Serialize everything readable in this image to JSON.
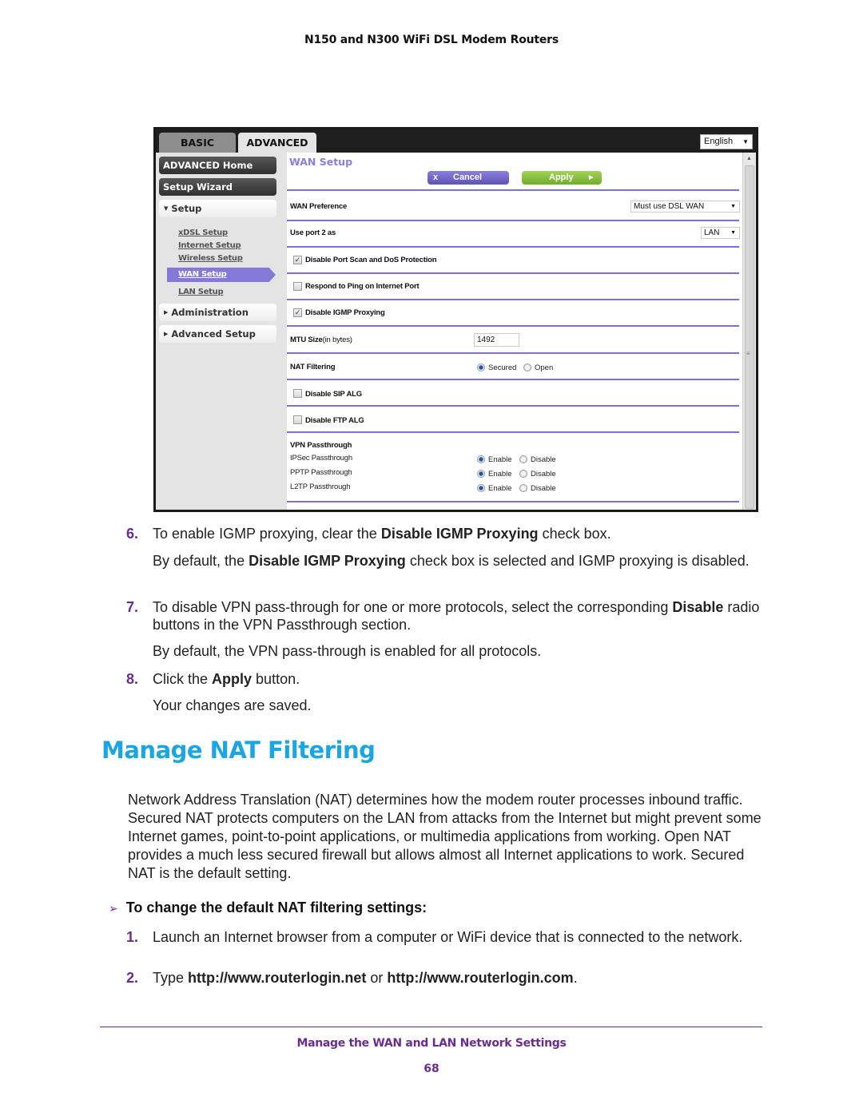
{
  "running_header": "N150 and N300 WiFi DSL Modem Routers",
  "router_ui": {
    "tabs": [
      {
        "label": "BASIC",
        "active": false
      },
      {
        "label": "ADVANCED",
        "active": true
      }
    ],
    "language_select": {
      "value": "English",
      "icon": "chevron-down-icon"
    },
    "sidebar": {
      "advanced_home": "ADVANCED Home",
      "setup_wizard": "Setup Wizard",
      "setup": {
        "label": "Setup",
        "expanded": true
      },
      "setup_links": [
        {
          "label": "xDSL Setup",
          "active": false
        },
        {
          "label": "Internet Setup",
          "active": false
        },
        {
          "label": "Wireless Setup",
          "active": false
        },
        {
          "label": "WAN Setup",
          "active": true
        },
        {
          "label": "LAN Setup",
          "active": false
        }
      ],
      "administration": "Administration",
      "advanced_setup": "Advanced Setup"
    },
    "page_title": "WAN Setup",
    "cancel_button": {
      "icon": "x",
      "label": "Cancel"
    },
    "apply_button": {
      "label": "Apply",
      "icon": "▸"
    },
    "wan_preference": {
      "label": "WAN Preference",
      "value": "Must use DSL WAN"
    },
    "use_port2": {
      "label": "Use port 2 as",
      "value": "LAN"
    },
    "checkboxes": {
      "disable_port_scan": {
        "label": "Disable Port Scan and DoS Protection",
        "checked": true
      },
      "respond_ping": {
        "label": "Respond to Ping on Internet Port",
        "checked": false
      },
      "disable_igmp": {
        "label": "Disable IGMP Proxying",
        "checked": true
      },
      "disable_sip": {
        "label": "Disable SIP ALG",
        "checked": false
      },
      "disable_ftp": {
        "label": "Disable FTP ALG",
        "checked": false
      }
    },
    "mtu": {
      "label": "MTU Size",
      "label_suffix": "(in bytes)",
      "value": "1492"
    },
    "nat_filtering": {
      "label": "NAT Filtering",
      "options": [
        "Secured",
        "Open"
      ],
      "selected": "Secured"
    },
    "vpn": {
      "heading": "VPN Passthrough",
      "enable_label": "Enable",
      "disable_label": "Disable",
      "rows": [
        {
          "label": "IPSec Passthrough",
          "selected": "Enable"
        },
        {
          "label": "PPTP Passthrough",
          "selected": "Enable"
        },
        {
          "label": "L2TP Passthrough",
          "selected": "Enable"
        }
      ]
    }
  },
  "steps_top": [
    {
      "num": "6.",
      "pre": "To enable IGMP proxying, clear the ",
      "bold": "Disable IGMP Proxying",
      "post": " check box."
    },
    {
      "num": "7.",
      "pre": "To disable VPN pass-through for one or more protocols, select the corresponding ",
      "bold": "Disable",
      "post": " radio buttons in the VPN Passthrough section."
    },
    {
      "num": "8.",
      "pre": "Click the ",
      "bold": "Apply",
      "post": " button."
    }
  ],
  "notes_top": [
    {
      "pre": "By default, the ",
      "bold": "Disable IGMP Proxying",
      "post": " check box is selected and IGMP proxying is disabled."
    },
    {
      "pre": "By default, the VPN pass-through is enabled for all protocols.",
      "bold": "",
      "post": ""
    },
    {
      "pre": "Your changes are saved.",
      "bold": "",
      "post": ""
    }
  ],
  "section_title": "Manage NAT Filtering",
  "intro": "Network Address Translation (NAT) determines how the modem router processes inbound traffic. Secured NAT protects computers on the LAN from attacks from the Internet but might prevent some Internet games, point-to-point applications, or multimedia applications from working. Open NAT provides a much less secured firewall but allows almost all Internet applications to work. Secured NAT is the default setting.",
  "procedure_heading": "To change the default NAT filtering settings:",
  "steps_bottom": [
    {
      "num": "1.",
      "text": "Launch an Internet browser from a computer or WiFi device that is connected to the network."
    },
    {
      "num": "2.",
      "pre": "Type ",
      "bold1": "http://www.routerlogin.net",
      "mid": " or ",
      "bold2": "http://www.routerlogin.com",
      "post": "."
    }
  ],
  "footer": {
    "title": "Manage the WAN and LAN Network Settings",
    "page": "68"
  },
  "colors": {
    "accent_purple": "#6b2c91",
    "title_blue": "#1aa5e3",
    "ui_purple": "#7a70dc",
    "apply_green": "#7cbb35"
  }
}
